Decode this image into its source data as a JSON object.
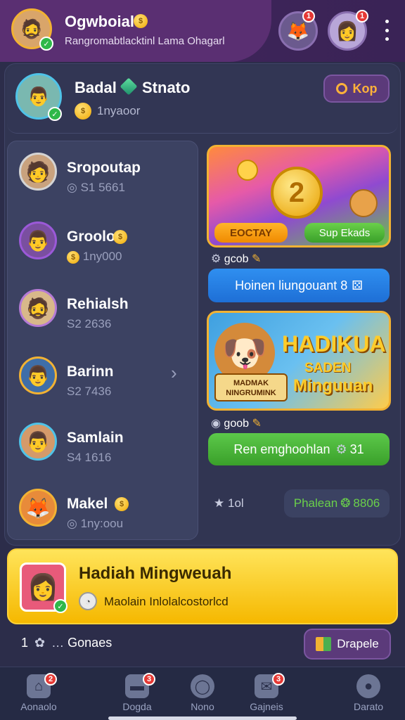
{
  "header": {
    "title": "Ogwboial",
    "subtitle": "Rangromabtlacktinl Lama Ohagarl",
    "notif_badge_1": "1",
    "notif_badge_2": "1"
  },
  "profile": {
    "name": "Badal",
    "name2": "Stnato",
    "coins": "1nyaoor",
    "search_label": "Kop"
  },
  "friends": [
    {
      "name": "Sropoutap",
      "sub": "S1 5661"
    },
    {
      "name": "Groolo",
      "sub": "1ny000"
    },
    {
      "name": "Rehialsh",
      "sub": "S2 2636"
    },
    {
      "name": "Barinn",
      "sub": "S2 7436"
    },
    {
      "name": "Samlain",
      "sub": "S4 1616"
    },
    {
      "name": "Makel",
      "sub": "1ny:oou"
    }
  ],
  "promo1": {
    "left_button": "EOCTAY",
    "right_button": "Sup Ekads",
    "caption": "gcob",
    "action": "Hoinen liungouant 8"
  },
  "promo2": {
    "headline": "HADIKUA",
    "subhead": "SADEN",
    "subhead2": "Minguuan",
    "banner_text": "MADMAK NINGRUMINK",
    "caption": "goob",
    "action": "Ren emghoohlan",
    "action_count": "31"
  },
  "stats": {
    "left": "1ol",
    "right": "Phalean",
    "right_count": "8806"
  },
  "reward": {
    "title": "Hadiah Mingweuah",
    "subtitle": "Maolain Inlolalcostorlcd"
  },
  "footer": {
    "count": "1",
    "label": "Gonaes",
    "button": "Drapele"
  },
  "nav": [
    {
      "label": "Aonaolo",
      "badge": "2"
    },
    {
      "label": "Dogda",
      "badge": "3"
    },
    {
      "label": "Nono",
      "badge": ""
    },
    {
      "label": "Gajneis",
      "badge": "3"
    },
    {
      "label": "Darato",
      "badge": ""
    }
  ]
}
